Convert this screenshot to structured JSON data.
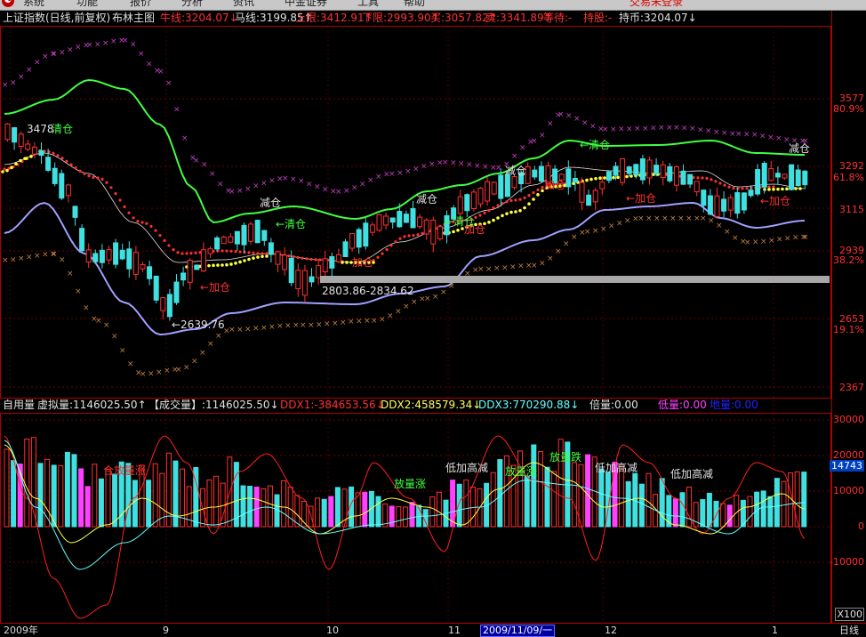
{
  "menubar": {
    "items": [
      "系统",
      "功能",
      "报价",
      "分析",
      "资讯",
      "中金证券",
      "工具",
      "帮助"
    ],
    "login_status": "交易未登录"
  },
  "main_panel": {
    "title": "上证指数(日线,前复权)",
    "indicator": "布林主图",
    "fields": [
      {
        "label": "牛线",
        "value": "3204.07",
        "arrow": "↓",
        "color": "#ff3030"
      },
      {
        "label": "马线",
        "value": "3199.85",
        "arrow": "↑",
        "color": "#e0e0e0"
      },
      {
        "label": "上限",
        "value": "3412.91",
        "arrow": "↑",
        "color": "#ff3030"
      },
      {
        "label": "下限",
        "value": "2993.90",
        "arrow": "↑",
        "color": "#ff3030"
      },
      {
        "label": "买",
        "value": "3057.82",
        "arrow": "↑",
        "color": "#ff3030"
      },
      {
        "label": "卖",
        "value": "3341.89",
        "arrow": "↑",
        "color": "#ff3030"
      },
      {
        "label": "等待",
        "value": "-",
        "arrow": "",
        "color": "#ff3030"
      },
      {
        "label": "持股",
        "value": "-",
        "arrow": "",
        "color": "#ff3030"
      },
      {
        "label": "持币",
        "value": "3204.07",
        "arrow": "↓",
        "color": "#e0e0e0"
      }
    ],
    "y_labels": [
      "3577",
      "80.9%",
      "3292",
      "61.8%",
      "3115",
      "2939",
      "38.2%",
      "2653",
      "19.1%",
      "2367"
    ],
    "annotations": {
      "high_price": "3478",
      "low_price": "2639.76",
      "range_label": "2803.86-2834.62",
      "clear": "清仓",
      "clear_arrow": "←清仓",
      "reduce": "减仓",
      "add": "←加仓",
      "add_plain": "加仓"
    }
  },
  "volume_panel": {
    "title": "自用量",
    "fields": [
      {
        "label": "虚拟量",
        "value": "1146025.50",
        "arrow": "↑",
        "color": "#e0e0e0"
      },
      {
        "label": "【成交量】",
        "value": "1146025.50",
        "arrow": "↓",
        "color": "#e0e0e0"
      },
      {
        "label": "DDX1",
        "value": "-384653.56",
        "arrow": "↓",
        "color": "#ff3030"
      },
      {
        "label": "DDX2",
        "value": "458579.34",
        "arrow": "↓",
        "color": "#ffff60"
      },
      {
        "label": "DDX3",
        "value": "770290.88",
        "arrow": "↓",
        "color": "#60ffff"
      },
      {
        "label": "倍量",
        "value": "0.00",
        "arrow": "",
        "color": "#e0e0e0"
      },
      {
        "label": "低量",
        "value": "0.00",
        "arrow": "",
        "color": "#ff40ff"
      },
      {
        "label": "地量",
        "value": "0.00",
        "arrow": "",
        "color": "#2020ff"
      }
    ],
    "y_labels": [
      "30000",
      "20000",
      "14743",
      "10000",
      "0",
      "-10000",
      "X100"
    ],
    "annotations": {
      "low_add_high_reduce": "低加高减",
      "volume_rise": "放量涨",
      "volume_fall": "放量跌"
    }
  },
  "date_axis": {
    "labels": [
      "2009年",
      "9",
      "10",
      "11",
      "2009/11/09/一",
      "12",
      "1"
    ]
  },
  "colors": {
    "up": "#ff3030",
    "down": "#40e0e0",
    "upper_band": "#40ff40",
    "lower_band": "#a0a0ff",
    "mid_band": "#ff3030",
    "buy_dots": "#ffff40",
    "grid": "#800000"
  }
}
